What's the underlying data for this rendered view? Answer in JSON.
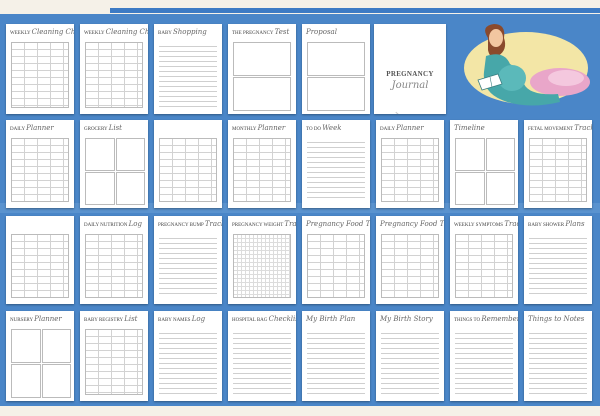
{
  "row1": [
    {
      "pre": "WEEKLY",
      "script": "Cleaning Checklist",
      "pattern": "grid"
    },
    {
      "pre": "WEEKLY",
      "script": "Cleaning Checklist",
      "pattern": "grid"
    },
    {
      "pre": "BABY",
      "script": "Shopping",
      "pattern": "lines"
    },
    {
      "pre": "THE PREGNANCY",
      "script": "Test",
      "pattern": "boxes2"
    },
    {
      "pre": "",
      "script": "Proposal",
      "pattern": "boxes2"
    }
  ],
  "cover": {
    "title": "PREGNANCY",
    "subtitle": "Journal"
  },
  "row2": [
    {
      "pre": "DAILY",
      "script": "Planner",
      "pattern": "grid"
    },
    {
      "pre": "GROCERY",
      "script": "List",
      "pattern": "boxes"
    },
    {
      "pre": "",
      "script": "",
      "pattern": "grid"
    },
    {
      "pre": "MONTHLY",
      "script": "Planner",
      "pattern": "grid"
    },
    {
      "pre": "TO DO",
      "script": "Week",
      "pattern": "lines"
    },
    {
      "pre": "DAILY",
      "script": "Planner",
      "pattern": "grid"
    },
    {
      "pre": "",
      "script": "Timeline",
      "pattern": "boxes"
    },
    {
      "pre": "FETAL MOVEMENT",
      "script": "Tracker",
      "pattern": "grid"
    }
  ],
  "row3": [
    {
      "pre": "",
      "script": "",
      "pattern": "grid"
    },
    {
      "pre": "DAILY NUTRITION",
      "script": "Log",
      "pattern": "grid"
    },
    {
      "pre": "PREGNANCY BUMP",
      "script": "Tracker",
      "pattern": "lines"
    },
    {
      "pre": "PREGNANCY WEIGHT",
      "script": "Tracker",
      "pattern": "fine"
    },
    {
      "pre": "",
      "script": "Pregnancy Food Tracker",
      "pattern": "grid"
    },
    {
      "pre": "",
      "script": "Pregnancy Food Tracker",
      "pattern": "grid"
    },
    {
      "pre": "WEEKLY SYMPTOMS",
      "script": "Tracker",
      "pattern": "grid"
    },
    {
      "pre": "BABY SHOWER",
      "script": "Plans",
      "pattern": "lines"
    }
  ],
  "row4": [
    {
      "pre": "NURSERY",
      "script": "Planner",
      "pattern": "boxes"
    },
    {
      "pre": "BABY REGISTRY",
      "script": "List",
      "pattern": "grid"
    },
    {
      "pre": "BABY NAMES",
      "script": "Log",
      "pattern": "lines"
    },
    {
      "pre": "HOSPITAL BAG",
      "script": "Checklist",
      "pattern": "lines"
    },
    {
      "pre": "",
      "script": "My Birth Plan",
      "pattern": "lines"
    },
    {
      "pre": "",
      "script": "My Birth Story",
      "pattern": "lines"
    },
    {
      "pre": "THINGS TO",
      "script": "Remember",
      "pattern": "lines"
    },
    {
      "pre": "",
      "script": "Things to Notes",
      "pattern": "lines"
    }
  ],
  "colors": {
    "background": "#4a86c8",
    "accent": "#9ccfd0",
    "pillow": "#e9a6c9"
  },
  "icons": {
    "illustration": "pregnant-woman-reading-icon"
  }
}
